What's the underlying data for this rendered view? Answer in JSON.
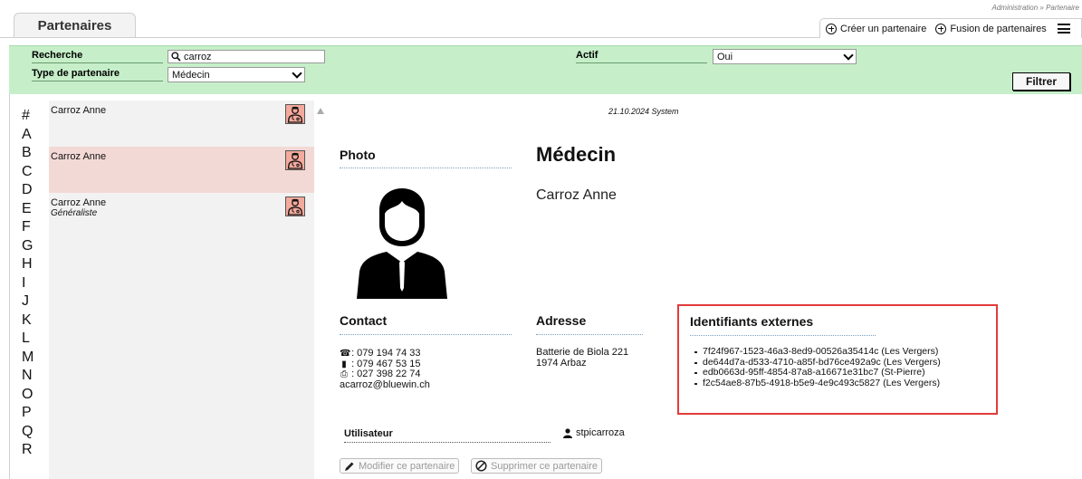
{
  "page": {
    "tab_title": "Partenaires",
    "breadcrumb": "Administration » Partenaire",
    "actions": {
      "create_label": "Créer un partenaire",
      "merge_label": "Fusion de partenaires"
    }
  },
  "filter": {
    "search_label": "Recherche",
    "search_value": "carroz",
    "type_label": "Type de partenaire",
    "type_value": "Médecin",
    "active_label": "Actif",
    "active_value": "Oui",
    "filter_button": "Filtrer"
  },
  "alphabet": [
    "#",
    "A",
    "B",
    "C",
    "D",
    "E",
    "F",
    "G",
    "H",
    "I",
    "J",
    "K",
    "L",
    "M",
    "N",
    "O",
    "P",
    "Q",
    "R"
  ],
  "results": [
    {
      "name": "Carroz Anne",
      "subtitle": "",
      "icon": "doctor-icon",
      "selected": false
    },
    {
      "name": "Carroz Anne",
      "subtitle": "",
      "icon": "doctor-icon",
      "selected": true
    },
    {
      "name": "Carroz Anne",
      "subtitle": "Généraliste",
      "icon": "doctor-icon",
      "selected": false
    }
  ],
  "detail": {
    "stamp": "21.10.2024 System",
    "photo_label": "Photo",
    "type": "Médecin",
    "name": "Carroz Anne",
    "contact_label": "Contact",
    "phone": ": 079 194 74 33",
    "mobile": ": 079 467 53 15",
    "fax": ": 027 398 22 74",
    "email": "acarroz@bluewin.ch",
    "address_label": "Adresse",
    "address_line1": "Batterie de Biola 221",
    "address_line2": "1974 Arbaz",
    "external_ids_label": "Identifiants externes",
    "external_ids": [
      "7f24f967-1523-46a3-8ed9-00526a35414c (Les Vergers)",
      "de644d7a-d533-4710-a85f-bd76ce492a9c (Les Vergers)",
      "edb0663d-95ff-4854-87a8-a16671e31bc7 (St-Pierre)",
      "f2c54ae8-87b5-4918-b5e9-4e9c493c5827 (Les Vergers)"
    ],
    "user_label": "Utilisateur",
    "user_value": "stpicarroza",
    "edit_button": "Modifier ce partenaire",
    "delete_button": "Supprimer ce partenaire"
  }
}
